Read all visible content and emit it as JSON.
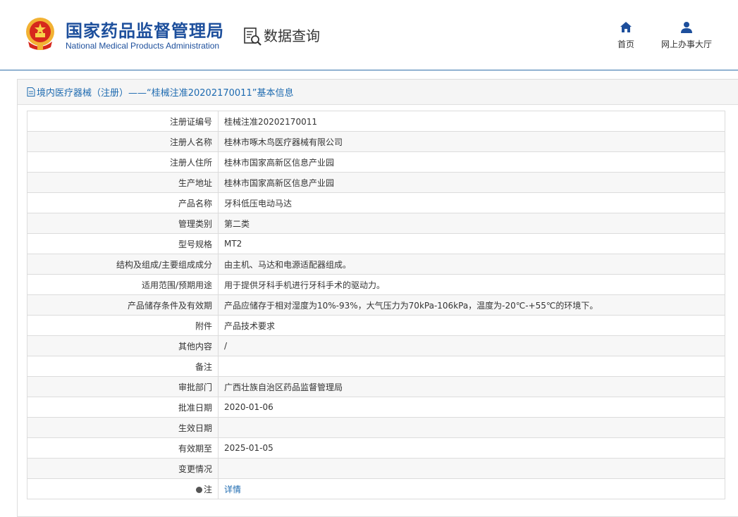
{
  "header": {
    "title_cn": "国家药品监督管理局",
    "title_en": "National Medical Products Administration",
    "query_title": "数据查询",
    "nav": {
      "home": "首页",
      "service_hall": "网上办事大厅"
    }
  },
  "panel": {
    "title": "境内医疗器械（注册）——“桂械注准20202170011”基本信息"
  },
  "rows": [
    {
      "label": "注册证编号",
      "value": "桂械注准20202170011"
    },
    {
      "label": "注册人名称",
      "value": "桂林市啄木鸟医疗器械有限公司"
    },
    {
      "label": "注册人住所",
      "value": "桂林市国家高新区信息产业园"
    },
    {
      "label": "生产地址",
      "value": "桂林市国家高新区信息产业园"
    },
    {
      "label": "产品名称",
      "value": "牙科低压电动马达"
    },
    {
      "label": "管理类别",
      "value": "第二类"
    },
    {
      "label": "型号规格",
      "value": "MT2"
    },
    {
      "label": "结构及组成/主要组成成分",
      "value": "由主机、马达和电源适配器组成。"
    },
    {
      "label": "适用范围/预期用途",
      "value": "用于提供牙科手机进行牙科手术的驱动力。"
    },
    {
      "label": "产品储存条件及有效期",
      "value": "产品应储存于相对湿度为10%-93%，大气压力为70kPa-106kPa，温度为-20℃-+55℃的环境下。"
    },
    {
      "label": "附件",
      "value": "产品技术要求"
    },
    {
      "label": "其他内容",
      "value": "/"
    },
    {
      "label": "备注",
      "value": ""
    },
    {
      "label": "审批部门",
      "value": "广西壮族自治区药品监督管理局"
    },
    {
      "label": "批准日期",
      "value": "2020-01-06"
    },
    {
      "label": "生效日期",
      "value": ""
    },
    {
      "label": "有效期至",
      "value": "2025-01-05"
    },
    {
      "label": "变更情况",
      "value": ""
    }
  ],
  "note_row": {
    "label": "注",
    "link": "详情"
  },
  "colors": {
    "brand": "#1d4f9c",
    "link": "#1d6ab0",
    "emblem": "#d6281d"
  }
}
